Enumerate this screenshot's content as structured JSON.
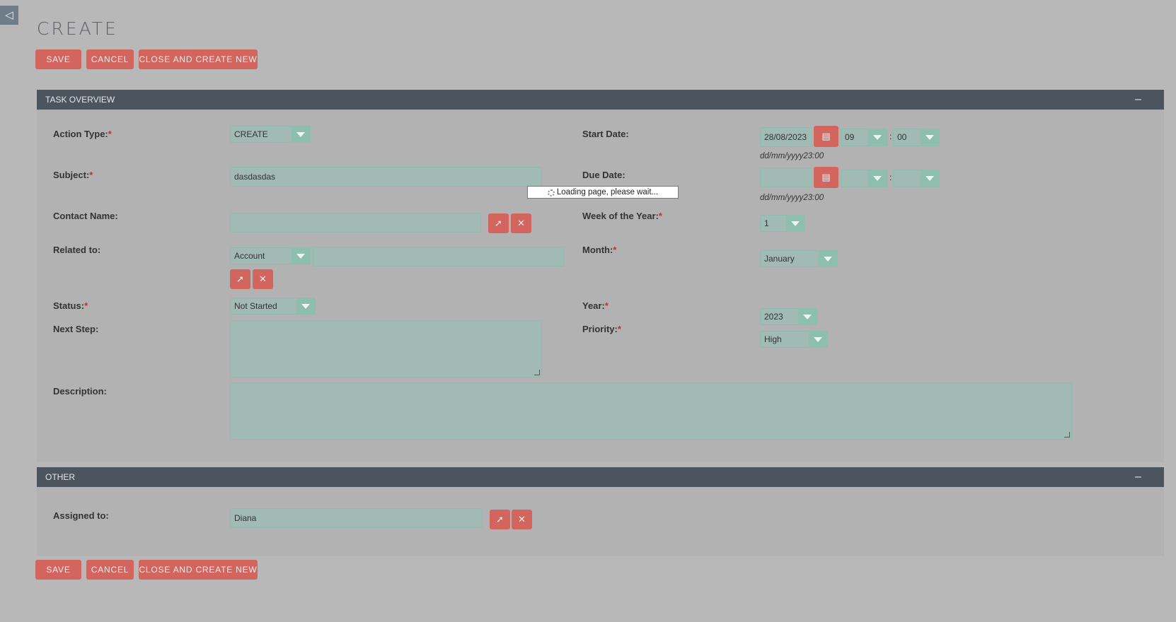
{
  "page": {
    "title": "CREATE"
  },
  "sidebar_toggle": {
    "glyph": "◁"
  },
  "toolbar": {
    "save": "SAVE",
    "cancel": "CANCEL",
    "close_create_new": "CLOSE AND CREATE NEW"
  },
  "panels": {
    "task_overview": {
      "title": "TASK OVERVIEW",
      "collapse": "–"
    },
    "other": {
      "title": "OTHER",
      "collapse": "–"
    }
  },
  "form": {
    "action_type": {
      "label": "Action Type:",
      "required": "*",
      "value": "CREATE"
    },
    "subject": {
      "label": "Subject:",
      "required": "*",
      "value": "dasdasdas"
    },
    "contact_name": {
      "label": "Contact Name:",
      "value": ""
    },
    "related_to": {
      "label": "Related to:",
      "type_value": "Account",
      "value": ""
    },
    "status": {
      "label": "Status:",
      "required": "*",
      "value": "Not Started"
    },
    "next_step": {
      "label": "Next Step:",
      "value": ""
    },
    "description": {
      "label": "Description:",
      "value": ""
    },
    "start_date": {
      "label": "Start Date:",
      "date": "28/08/2023",
      "hour": "09",
      "minute": "00",
      "format_hint": "dd/mm/yyyy23:00"
    },
    "due_date": {
      "label": "Due Date:",
      "date": "",
      "hour": "",
      "minute": "",
      "format_hint": "dd/mm/yyyy23:00"
    },
    "week_of_year": {
      "label": "Week of the Year:",
      "required": "*",
      "value": "1"
    },
    "month": {
      "label": "Month:",
      "required": "*",
      "value": "January"
    },
    "year": {
      "label": "Year:",
      "required": "*",
      "value": "2023"
    },
    "priority": {
      "label": "Priority:",
      "required": "*",
      "value": "High"
    },
    "assigned_to": {
      "label": "Assigned to:",
      "value": "Diana"
    },
    "time_separator": ":"
  },
  "loading_message": "Loading page, please wait...",
  "colors": {
    "button": "#d2665f",
    "field": "#a1bab3",
    "header": "#4c555e",
    "background": "#b8b8b8"
  }
}
